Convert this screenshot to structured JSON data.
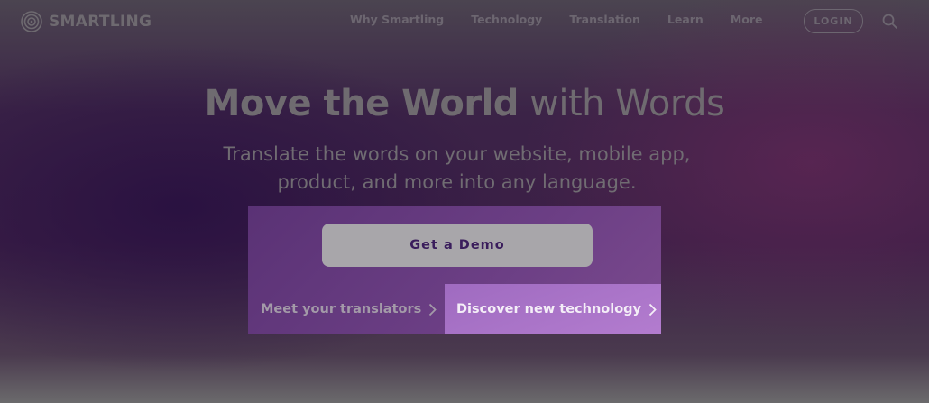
{
  "brand": {
    "name": "SMARTLING"
  },
  "nav": {
    "items": [
      {
        "label": "Why Smartling"
      },
      {
        "label": "Technology"
      },
      {
        "label": "Translation"
      },
      {
        "label": "Learn"
      },
      {
        "label": "More"
      }
    ],
    "login_label": "LOGIN",
    "search_icon": "search-icon"
  },
  "hero": {
    "headline_bold": "Move the World",
    "headline_light": " with Words",
    "subhead": "Translate the words on your website, mobile app, product, and more into any language.",
    "demo_label": "Get a Demo",
    "link_left_label": "Meet your translators",
    "link_right_label": "Discover new technology"
  },
  "colors": {
    "panel": "#6c3f85",
    "demo_button": "#a8a6aa",
    "demo_text": "#3a1d5c",
    "highlight": "#b37ccf"
  }
}
